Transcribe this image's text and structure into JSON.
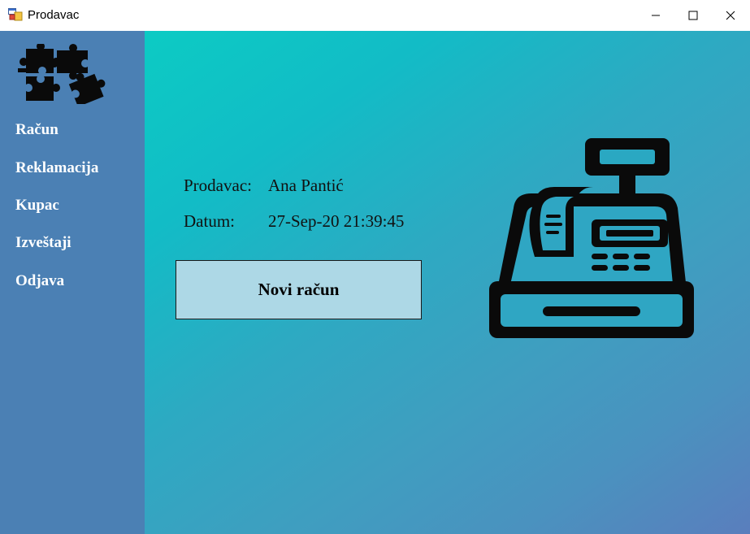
{
  "window": {
    "title": "Prodavac",
    "icons": {
      "app": "app-window-icon",
      "minimize": "minimize-icon",
      "maximize": "maximize-icon",
      "close": "close-icon"
    }
  },
  "sidebar": {
    "logo_icon": "puzzle-pieces-icon",
    "items": [
      {
        "label": "Račun"
      },
      {
        "label": "Reklamacija"
      },
      {
        "label": "Kupac"
      },
      {
        "label": "Izveštaji"
      },
      {
        "label": "Odjava"
      }
    ]
  },
  "main": {
    "seller_label": "Prodavac:",
    "seller_value": "Ana Pantić",
    "date_label": "Datum:",
    "date_value": "27-Sep-20 21:39:45",
    "new_receipt_button": "Novi račun",
    "illustration_icon": "cash-register-icon"
  },
  "colors": {
    "sidebar_bg": "#4b80b4",
    "main_gradient_start": "#0ccbc4",
    "main_gradient_end": "#5a7ebd",
    "button_bg": "#add8e6"
  }
}
